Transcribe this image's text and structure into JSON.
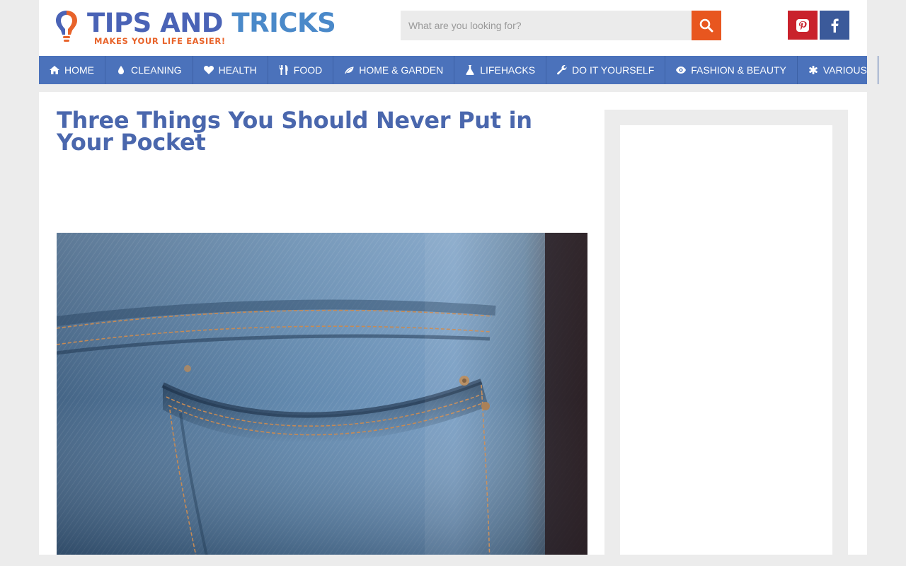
{
  "brand": {
    "title_part1": "TIPS AND",
    "title_part2": "TRICKS",
    "tagline": "MAKES YOUR LIFE EASIER!",
    "primary_color": "#4a63b6",
    "accent_color": "#e8632a"
  },
  "search": {
    "placeholder": "What are you looking for?",
    "value": "",
    "button_icon": "search-icon",
    "button_color": "#e8561f"
  },
  "social": [
    {
      "name": "pinterest",
      "icon": "pinterest-icon",
      "color": "#c9222c"
    },
    {
      "name": "facebook",
      "icon": "facebook-icon",
      "color": "#3b5a9a"
    }
  ],
  "nav": {
    "color": "#4b72bb",
    "items": [
      {
        "label": "HOME",
        "icon": "home-icon"
      },
      {
        "label": "CLEANING",
        "icon": "drop-icon"
      },
      {
        "label": "HEALTH",
        "icon": "heart-icon"
      },
      {
        "label": "FOOD",
        "icon": "cutlery-icon"
      },
      {
        "label": "HOME & GARDEN",
        "icon": "leaf-icon"
      },
      {
        "label": "LIFEHACKS",
        "icon": "flask-icon"
      },
      {
        "label": "DO IT YOURSELF",
        "icon": "wrench-icon"
      },
      {
        "label": "FASHION & BEAUTY",
        "icon": "eye-icon"
      },
      {
        "label": "VARIOUS",
        "icon": "asterisk-icon"
      }
    ]
  },
  "article": {
    "title": "Three Things You Should Never Put in Your Pocket",
    "hero_image": "jeans-pocket-photo"
  }
}
